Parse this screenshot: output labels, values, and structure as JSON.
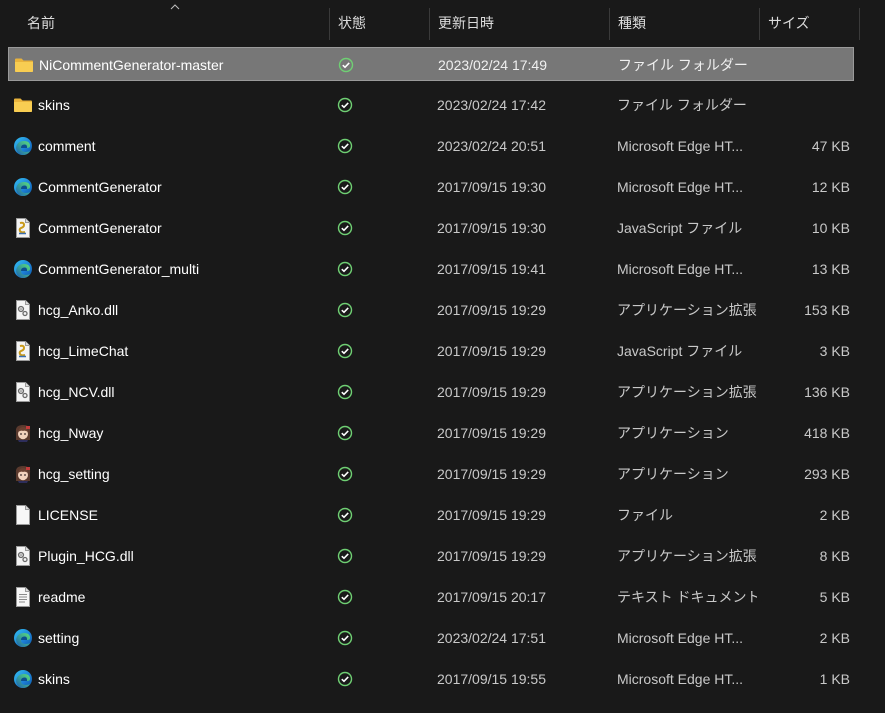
{
  "columns": {
    "name": "名前",
    "status": "状態",
    "date": "更新日時",
    "type": "種類",
    "size": "サイズ"
  },
  "colors": {
    "background": "#191919",
    "selected_row": "#777777",
    "folder": "#f4c542",
    "status_ok": "#6fcf73"
  },
  "files": [
    {
      "name": "NiCommentGenerator-master",
      "icon": "folder-icon",
      "status": "synced",
      "date": "2023/02/24 17:49",
      "type": "ファイル フォルダー",
      "size": "",
      "selected": true
    },
    {
      "name": "skins",
      "icon": "folder-icon",
      "status": "synced",
      "date": "2023/02/24 17:42",
      "type": "ファイル フォルダー",
      "size": ""
    },
    {
      "name": "comment",
      "icon": "edge-icon",
      "status": "synced",
      "date": "2023/02/24 20:51",
      "type": "Microsoft Edge HT...",
      "size": "47 KB"
    },
    {
      "name": "CommentGenerator",
      "icon": "edge-icon",
      "status": "synced",
      "date": "2017/09/15 19:30",
      "type": "Microsoft Edge HT...",
      "size": "12 KB"
    },
    {
      "name": "CommentGenerator",
      "icon": "js-file-icon",
      "status": "synced",
      "date": "2017/09/15 19:30",
      "type": "JavaScript ファイル",
      "size": "10 KB"
    },
    {
      "name": "CommentGenerator_multi",
      "icon": "edge-icon",
      "status": "synced",
      "date": "2017/09/15 19:41",
      "type": "Microsoft Edge HT...",
      "size": "13 KB"
    },
    {
      "name": "hcg_Anko.dll",
      "icon": "dll-file-icon",
      "status": "synced",
      "date": "2017/09/15 19:29",
      "type": "アプリケーション拡張",
      "size": "153 KB"
    },
    {
      "name": "hcg_LimeChat",
      "icon": "js-file-icon",
      "status": "synced",
      "date": "2017/09/15 19:29",
      "type": "JavaScript ファイル",
      "size": "3 KB"
    },
    {
      "name": "hcg_NCV.dll",
      "icon": "dll-file-icon",
      "status": "synced",
      "date": "2017/09/15 19:29",
      "type": "アプリケーション拡張",
      "size": "136 KB"
    },
    {
      "name": "hcg_Nway",
      "icon": "app-character-icon",
      "status": "synced",
      "date": "2017/09/15 19:29",
      "type": "アプリケーション",
      "size": "418 KB"
    },
    {
      "name": "hcg_setting",
      "icon": "app-character-icon",
      "status": "synced",
      "date": "2017/09/15 19:29",
      "type": "アプリケーション",
      "size": "293 KB"
    },
    {
      "name": "LICENSE",
      "icon": "blank-file-icon",
      "status": "synced",
      "date": "2017/09/15 19:29",
      "type": "ファイル",
      "size": "2 KB"
    },
    {
      "name": "Plugin_HCG.dll",
      "icon": "dll-file-icon",
      "status": "synced",
      "date": "2017/09/15 19:29",
      "type": "アプリケーション拡張",
      "size": "8 KB"
    },
    {
      "name": "readme",
      "icon": "text-file-icon",
      "status": "synced",
      "date": "2017/09/15 20:17",
      "type": "テキスト ドキュメント",
      "size": "5 KB"
    },
    {
      "name": "setting",
      "icon": "edge-icon",
      "status": "synced",
      "date": "2023/02/24 17:51",
      "type": "Microsoft Edge HT...",
      "size": "2 KB"
    },
    {
      "name": "skins",
      "icon": "edge-icon",
      "status": "synced",
      "date": "2017/09/15 19:55",
      "type": "Microsoft Edge HT...",
      "size": "1 KB"
    }
  ]
}
